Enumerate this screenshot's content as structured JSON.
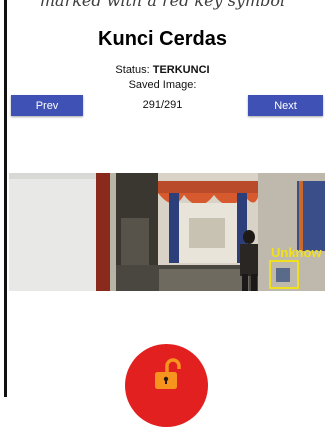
{
  "caption_fragment": "marked with a red key symbol",
  "app": {
    "title": "Kunci Cerdas",
    "status_label": "Status:",
    "status_value": "TERKUNCI",
    "saved_image_label": "Saved Image:",
    "image_counter": "291/291"
  },
  "nav": {
    "prev_label": "Prev",
    "next_label": "Next"
  },
  "camera": {
    "detection_label": "Unknow",
    "detection_color": "#f0e020"
  },
  "lock_button": {
    "icon": "open-padlock-icon",
    "state": "unlocked"
  },
  "colors": {
    "button_blue": "#3f51b5",
    "lock_red": "#e22020",
    "padlock_orange": "#f7941d"
  }
}
